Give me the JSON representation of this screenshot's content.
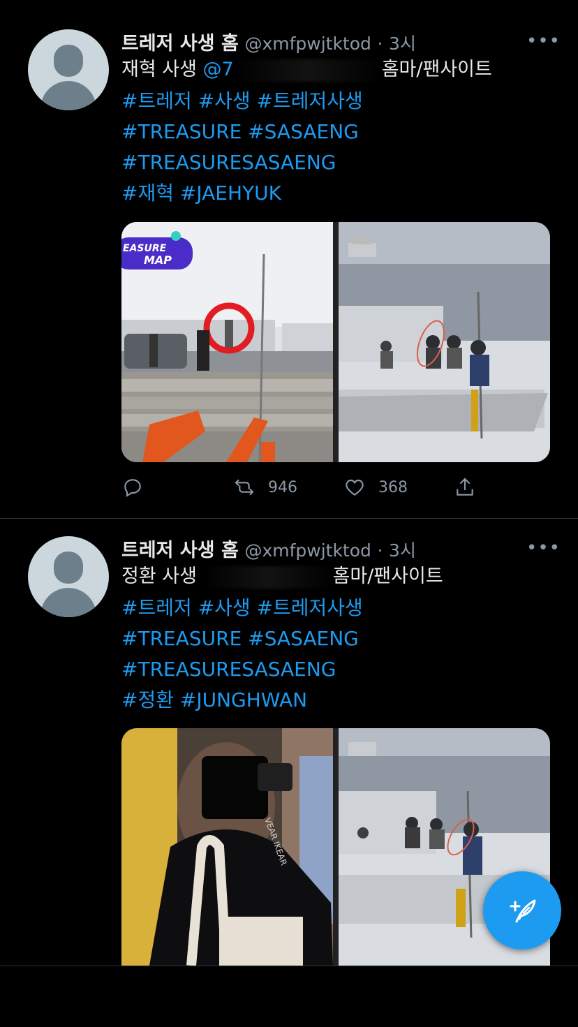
{
  "tweets": [
    {
      "author_name": "트레저 사생 홈",
      "author_handle": "@xmfpwjtktod",
      "separator": "·",
      "time": "3시",
      "more_label": "•••",
      "text_prefix": "재혁 사생 ",
      "mention_visible": "@7",
      "text_suffix": "홈마/팬사이트",
      "hashtag_lines": [
        "#트레저 #사생 #트레저사생",
        "#TREASURE #SASAENG",
        "#TREASURESASAENG",
        "#재혁 #JAEHYUK"
      ],
      "image_overlay_top": "EASURE",
      "image_overlay_bottom": "MAP",
      "stats": {
        "reply": "",
        "retweet": "946",
        "like": "368"
      }
    },
    {
      "author_name": "트레저 사생 홈",
      "author_handle": "@xmfpwjtktod",
      "separator": "·",
      "time": "3시",
      "more_label": "•••",
      "text_prefix": "정환 사생 ",
      "mention_visible": "",
      "text_suffix": "홈마/팬사이트",
      "hashtag_lines": [
        "#트레저 #사생 #트레저사생",
        "#TREASURE #SASAENG",
        "#TREASURESASAENG",
        "#정환 #JUNGHWAN"
      ]
    }
  ],
  "colors": {
    "background": "#000000",
    "link": "#1d9bf0",
    "muted": "#8b98a5",
    "fab": "#1d9bf0"
  },
  "icons": {
    "reply": "reply-icon",
    "retweet": "retweet-icon",
    "like": "heart-icon",
    "share": "share-icon",
    "compose": "compose-tweet-icon"
  }
}
